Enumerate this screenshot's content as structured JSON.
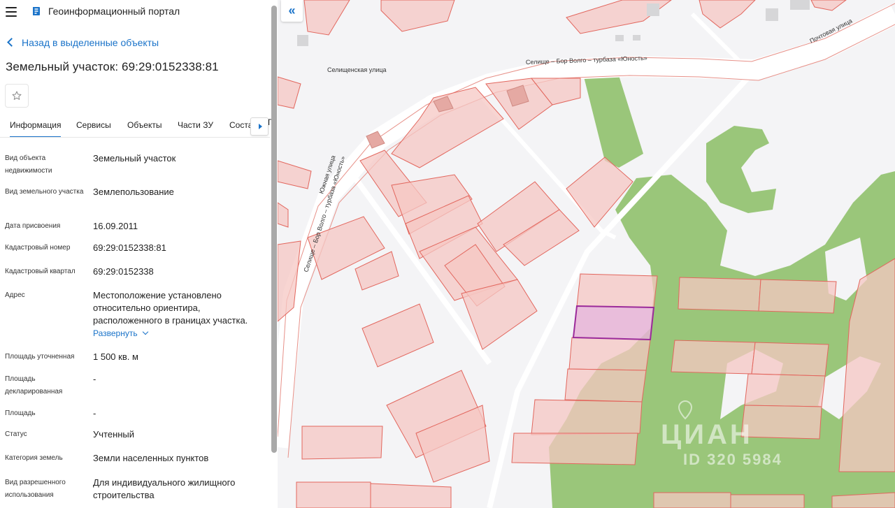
{
  "header": {
    "app_title": "Геоинформационный портал",
    "menu_icon": "menu-icon",
    "logo_icon": "portal-logo-icon"
  },
  "nav": {
    "back_label": "Назад в выделенные объекты"
  },
  "object": {
    "title": "Земельный участок: 69:29:0152338:81"
  },
  "tabs": [
    {
      "label": "Информация",
      "active": true
    },
    {
      "label": "Сервисы"
    },
    {
      "label": "Объекты"
    },
    {
      "label": "Части ЗУ"
    },
    {
      "label": "Соста"
    }
  ],
  "tabs_overflow": "Г",
  "details": [
    {
      "label": "Вид объекта недвижимости",
      "value": "Земельный участок"
    },
    {
      "label": "Вид земельного участка",
      "value": "Землепользование"
    },
    {
      "label": "Дата присвоения",
      "value": "16.09.2011"
    },
    {
      "label": "Кадастровый номер",
      "value": "69:29:0152338:81"
    },
    {
      "label": "Кадастровый квартал",
      "value": "69:29:0152338"
    },
    {
      "label": "Адрес",
      "value": "Местоположение установлено относительно ориентира, расположенного в границах участка.",
      "expand_label": "Развернуть"
    },
    {
      "label": "Площадь уточненная",
      "value": "1 500 кв. м"
    },
    {
      "label": "Площадь декларированная",
      "value": "-"
    },
    {
      "label": "Площадь",
      "value": "-"
    },
    {
      "label": "Статус",
      "value": "Учтенный"
    },
    {
      "label": "Категория земель",
      "value": "Земли населенных пунктов"
    },
    {
      "label": "Вид разрешенного использования",
      "value": "Для индивидуального жилищного строительства"
    }
  ],
  "map": {
    "streets": {
      "seliger": "Селищенская улица",
      "road_top": "Селище – Бор Волго – турбаза «Юность»",
      "pochtovaya": "Почтовая улица",
      "road_vertical": "Селище – Бор Волго – турбаза «Юность»",
      "yuzhnaya": "Южная улица"
    },
    "watermark": {
      "brand": "ЦИАН",
      "id": "ID 320 5984"
    },
    "colors": {
      "parcel_fill": "#f6c7c3",
      "parcel_stroke": "#e2665d",
      "forest": "#9ac67a",
      "selected_fill": "#e6b3d6",
      "selected_stroke": "#9b2a9a"
    }
  }
}
